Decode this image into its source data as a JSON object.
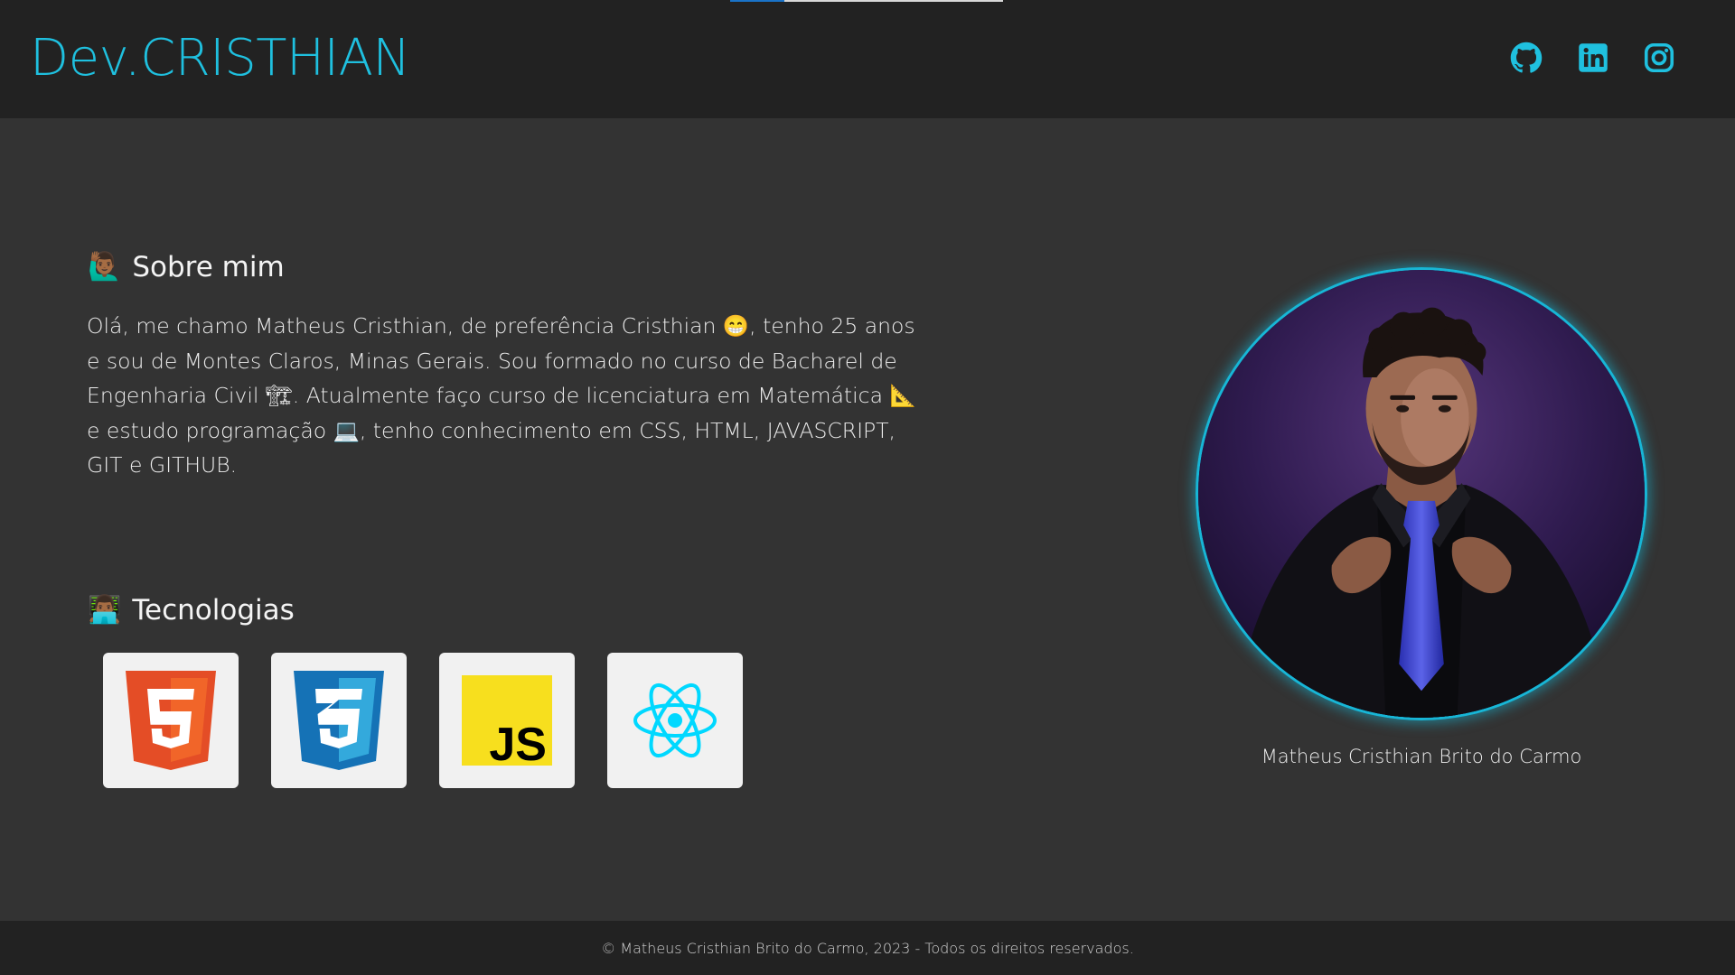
{
  "header": {
    "logo": "Dev.CRISTHIAN",
    "social": [
      {
        "name": "GitHub",
        "icon": "github-icon"
      },
      {
        "name": "LinkedIn",
        "icon": "linkedin-icon"
      },
      {
        "name": "Instagram",
        "icon": "instagram-icon"
      }
    ]
  },
  "about": {
    "emoji": "🙋🏾‍♂️",
    "title": "Sobre mim",
    "text": "Olá, me chamo Matheus Cristhian, de preferência Cristhian 😁, tenho 25 anos e sou de Montes Claros, Minas Gerais. Sou formado no curso de Bacharel de Engenharia Civil 🏗. Atualmente faço curso de licenciatura em Matemática 📐 e estudo programação 💻, tenho conhecimento em CSS, HTML, JAVASCRIPT, GIT e GITHUB."
  },
  "technologies": {
    "emoji": "👨🏾‍💻",
    "title": "Tecnologias",
    "items": [
      {
        "name": "HTML5",
        "icon": "html5-icon"
      },
      {
        "name": "CSS3",
        "icon": "css3-icon"
      },
      {
        "name": "JavaScript",
        "icon": "javascript-icon"
      },
      {
        "name": "React",
        "icon": "react-icon"
      }
    ],
    "js_badge": "JS"
  },
  "profile": {
    "caption": "Matheus Cristhian Brito do Carmo"
  },
  "footer": {
    "text": "© Matheus Cristhian Brito do Carmo, 2023 - Todos os direitos reservados."
  },
  "colors": {
    "accent": "#1fc0df",
    "header_bg": "#222222",
    "body_bg": "#333333",
    "html5": "#e44d26",
    "css3": "#1572b6",
    "javascript": "#f7df1e",
    "react": "#00d8ff"
  }
}
